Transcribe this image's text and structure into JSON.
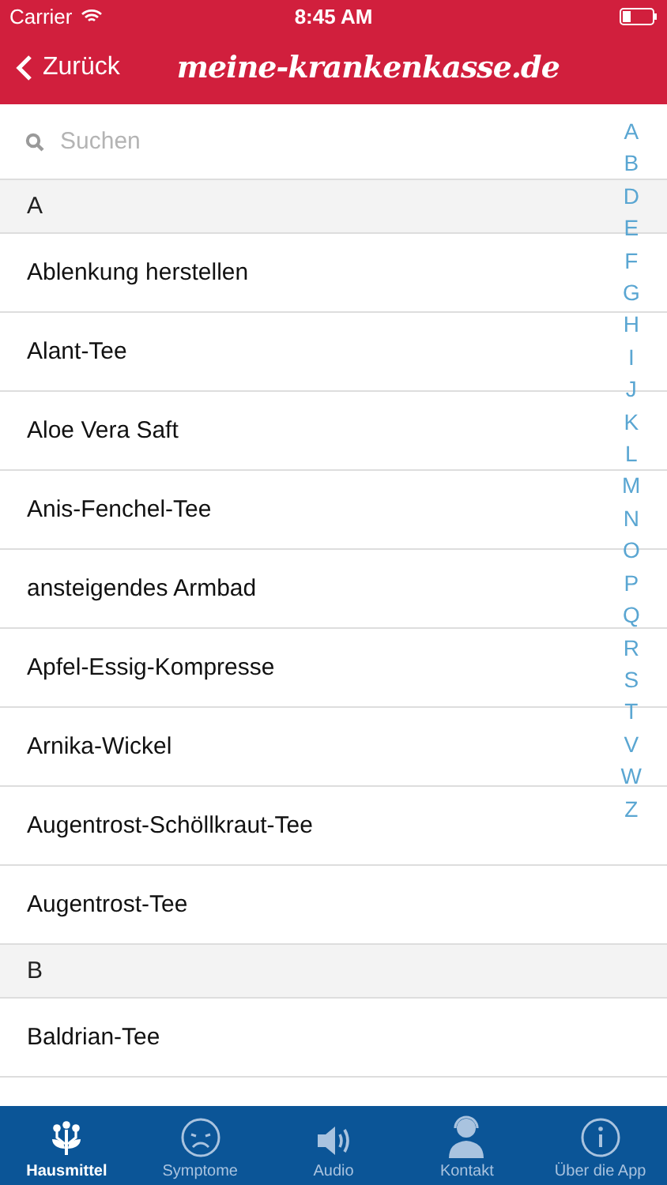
{
  "status_bar": {
    "carrier": "Carrier",
    "time": "8:45 AM"
  },
  "nav": {
    "back": "Zurück",
    "logo": "meine-krankenkasse.de"
  },
  "search": {
    "placeholder": "Suchen"
  },
  "sections": [
    {
      "header": "A",
      "items": [
        "Ablenkung herstellen",
        "Alant-Tee",
        "Aloe Vera Saft",
        "Anis-Fenchel-Tee",
        "ansteigendes Armbad",
        "Apfel-Essig-Kompresse",
        "Arnika-Wickel",
        "Augentrost-Schöllkraut-Tee",
        "Augentrost-Tee"
      ]
    },
    {
      "header": "B",
      "items": [
        "Baldrian-Tee"
      ]
    }
  ],
  "index": [
    "A",
    "B",
    "D",
    "E",
    "F",
    "G",
    "H",
    "I",
    "J",
    "K",
    "L",
    "M",
    "N",
    "O",
    "P",
    "Q",
    "R",
    "S",
    "T",
    "V",
    "W",
    "Z"
  ],
  "tabs": [
    {
      "label": "Hausmittel",
      "kind": "plant",
      "selected": true
    },
    {
      "label": "Symptome",
      "kind": "sad",
      "selected": false
    },
    {
      "label": "Audio",
      "kind": "speaker",
      "selected": false
    },
    {
      "label": "Kontakt",
      "kind": "agent",
      "selected": false
    },
    {
      "label": "Über die App",
      "kind": "info",
      "selected": false
    }
  ]
}
